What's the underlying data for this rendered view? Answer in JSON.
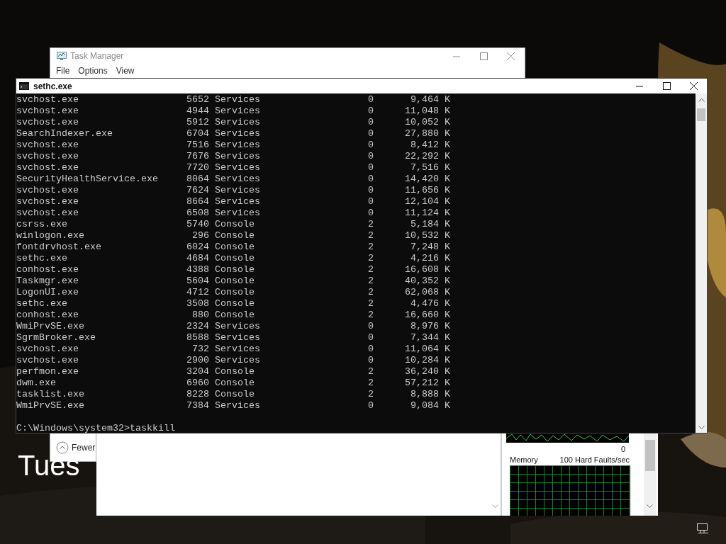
{
  "lock_screen": {
    "date_text": "Tues"
  },
  "task_manager": {
    "title": "Task Manager",
    "menu": [
      "File",
      "Options",
      "View"
    ],
    "fewer_details": "Fewer"
  },
  "resource_monitor": {
    "cpu_graph_min": "0",
    "memory_label": "Memory",
    "faults_label": "100 Hard Faults/sec"
  },
  "console": {
    "title": "sethc.exe",
    "rows": [
      {
        "image_name": "svchost.exe",
        "pid": "5652",
        "session_name": "Services",
        "session_num": "0",
        "mem_usage": "9,464 K"
      },
      {
        "image_name": "svchost.exe",
        "pid": "4944",
        "session_name": "Services",
        "session_num": "0",
        "mem_usage": "11,048 K"
      },
      {
        "image_name": "svchost.exe",
        "pid": "5912",
        "session_name": "Services",
        "session_num": "0",
        "mem_usage": "10,052 K"
      },
      {
        "image_name": "SearchIndexer.exe",
        "pid": "6704",
        "session_name": "Services",
        "session_num": "0",
        "mem_usage": "27,880 K"
      },
      {
        "image_name": "svchost.exe",
        "pid": "7516",
        "session_name": "Services",
        "session_num": "0",
        "mem_usage": "8,412 K"
      },
      {
        "image_name": "svchost.exe",
        "pid": "7676",
        "session_name": "Services",
        "session_num": "0",
        "mem_usage": "22,292 K"
      },
      {
        "image_name": "svchost.exe",
        "pid": "7720",
        "session_name": "Services",
        "session_num": "0",
        "mem_usage": "7,516 K"
      },
      {
        "image_name": "SecurityHealthService.exe",
        "pid": "8064",
        "session_name": "Services",
        "session_num": "0",
        "mem_usage": "14,420 K"
      },
      {
        "image_name": "svchost.exe",
        "pid": "7624",
        "session_name": "Services",
        "session_num": "0",
        "mem_usage": "11,656 K"
      },
      {
        "image_name": "svchost.exe",
        "pid": "8664",
        "session_name": "Services",
        "session_num": "0",
        "mem_usage": "12,104 K"
      },
      {
        "image_name": "svchost.exe",
        "pid": "6508",
        "session_name": "Services",
        "session_num": "0",
        "mem_usage": "11,124 K"
      },
      {
        "image_name": "csrss.exe",
        "pid": "5740",
        "session_name": "Console",
        "session_num": "2",
        "mem_usage": "5,184 K"
      },
      {
        "image_name": "winlogon.exe",
        "pid": "296",
        "session_name": "Console",
        "session_num": "2",
        "mem_usage": "10,532 K"
      },
      {
        "image_name": "fontdrvhost.exe",
        "pid": "6024",
        "session_name": "Console",
        "session_num": "2",
        "mem_usage": "7,248 K"
      },
      {
        "image_name": "sethc.exe",
        "pid": "4684",
        "session_name": "Console",
        "session_num": "2",
        "mem_usage": "4,216 K"
      },
      {
        "image_name": "conhost.exe",
        "pid": "4388",
        "session_name": "Console",
        "session_num": "2",
        "mem_usage": "16,608 K"
      },
      {
        "image_name": "Taskmgr.exe",
        "pid": "5604",
        "session_name": "Console",
        "session_num": "2",
        "mem_usage": "40,352 K"
      },
      {
        "image_name": "LogonUI.exe",
        "pid": "4712",
        "session_name": "Console",
        "session_num": "2",
        "mem_usage": "62,068 K"
      },
      {
        "image_name": "sethc.exe",
        "pid": "3508",
        "session_name": "Console",
        "session_num": "2",
        "mem_usage": "4,476 K"
      },
      {
        "image_name": "conhost.exe",
        "pid": "880",
        "session_name": "Console",
        "session_num": "2",
        "mem_usage": "16,660 K"
      },
      {
        "image_name": "WmiPrvSE.exe",
        "pid": "2324",
        "session_name": "Services",
        "session_num": "0",
        "mem_usage": "8,976 K"
      },
      {
        "image_name": "SgrmBroker.exe",
        "pid": "8588",
        "session_name": "Services",
        "session_num": "0",
        "mem_usage": "7,344 K"
      },
      {
        "image_name": "svchost.exe",
        "pid": "732",
        "session_name": "Services",
        "session_num": "0",
        "mem_usage": "11,064 K"
      },
      {
        "image_name": "svchost.exe",
        "pid": "2900",
        "session_name": "Services",
        "session_num": "0",
        "mem_usage": "10,284 K"
      },
      {
        "image_name": "perfmon.exe",
        "pid": "3204",
        "session_name": "Console",
        "session_num": "2",
        "mem_usage": "36,240 K"
      },
      {
        "image_name": "dwm.exe",
        "pid": "6960",
        "session_name": "Console",
        "session_num": "2",
        "mem_usage": "57,212 K"
      },
      {
        "image_name": "tasklist.exe",
        "pid": "8228",
        "session_name": "Console",
        "session_num": "2",
        "mem_usage": "8,888 K"
      },
      {
        "image_name": "WmiPrvSE.exe",
        "pid": "7384",
        "session_name": "Services",
        "session_num": "0",
        "mem_usage": "9,084 K"
      }
    ],
    "prompt": "C:\\Windows\\system32>taskkill"
  }
}
